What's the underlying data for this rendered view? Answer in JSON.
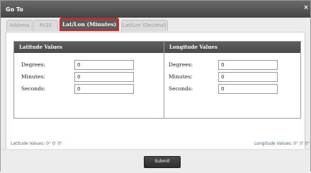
{
  "dialog": {
    "title": "Go To",
    "close_glyph": "×"
  },
  "tabs": [
    {
      "label": "Address"
    },
    {
      "label": "PLSS"
    },
    {
      "label": "Lat/Lon (Minutes)",
      "active": true
    },
    {
      "label": "Lat/Lon (Decimal)"
    }
  ],
  "latitude": {
    "header": "Latitude Values",
    "degrees_label": "Degrees:",
    "degrees_value": "0",
    "minutes_label": "Minutes:",
    "minutes_value": "0",
    "seconds_label": "Seconds:",
    "seconds_value": "0"
  },
  "longitude": {
    "header": "Longitude Values",
    "degrees_label": "Degrees:",
    "degrees_value": "0",
    "minutes_label": "Minutes:",
    "minutes_value": "0",
    "seconds_label": "Seconds:",
    "seconds_value": "0"
  },
  "status": {
    "latitude": "Latitude Values: 0° 0' 0\"",
    "longitude": "Longitude Values: 0° 0' 0\""
  },
  "actions": {
    "submit_label": "Submit"
  },
  "colors": {
    "active_tab_border": "#e0201c",
    "header_bg": "#555555",
    "status_text": "#4e6b79"
  }
}
